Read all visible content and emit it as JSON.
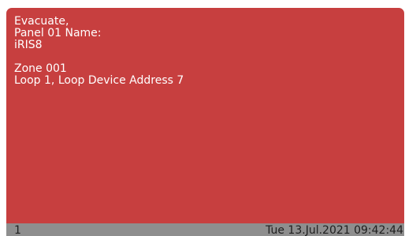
{
  "alarm": {
    "lines": [
      "Evacuate,",
      "Panel 01 Name:",
      "iRIS8",
      "",
      "Zone 001",
      "Loop 1, Loop Device Address 7"
    ]
  },
  "status_bar": {
    "index": "1",
    "datetime": "Tue 13.Jul.2021 09:42:44"
  },
  "colors": {
    "alarm_background": "#c73f3f",
    "status_bar_background": "#8e8e8e",
    "message_text": "#ffffff"
  }
}
